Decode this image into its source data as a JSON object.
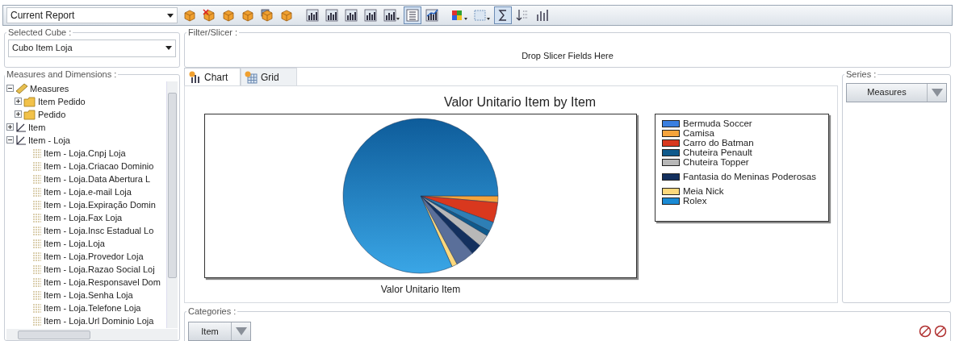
{
  "toolbar": {
    "report_select": {
      "value": "Current Report"
    },
    "buttons": [
      {
        "kind": "cube",
        "pressed": false
      },
      {
        "kind": "cube-delete",
        "pressed": false
      },
      {
        "kind": "cube",
        "pressed": false
      },
      {
        "kind": "cube",
        "pressed": false
      },
      {
        "kind": "cube-stack",
        "pressed": false
      },
      {
        "kind": "cube",
        "pressed": false
      },
      {
        "kind": "chart",
        "pressed": false
      },
      {
        "kind": "chart",
        "pressed": false
      },
      {
        "kind": "chart",
        "pressed": false
      },
      {
        "kind": "chart",
        "pressed": false
      },
      {
        "kind": "chart-menu",
        "pressed": false
      },
      {
        "kind": "list",
        "pressed": true
      },
      {
        "kind": "chart-line",
        "pressed": false
      },
      {
        "kind": "palette-menu",
        "pressed": false
      },
      {
        "kind": "grid-menu",
        "pressed": false
      },
      {
        "kind": "sum",
        "pressed": true
      },
      {
        "kind": "sort",
        "pressed": false
      },
      {
        "kind": "bars",
        "pressed": false
      }
    ]
  },
  "selected_cube": {
    "title": "Selected Cube :",
    "value": "Cubo Item Loja"
  },
  "filter_slicer": {
    "title": "Filter/Slicer :",
    "hint": "Drop Slicer Fields Here"
  },
  "measures_and_dimensions": {
    "title": "Measures and Dimensions :",
    "tree": [
      {
        "label": "Measures",
        "kind": "measures",
        "expanded": true,
        "children": [
          {
            "label": "Item Pedido",
            "kind": "folder",
            "expanded": false
          },
          {
            "label": "Pedido",
            "kind": "folder",
            "expanded": false
          }
        ]
      },
      {
        "label": "Item",
        "kind": "dimension",
        "expanded": false
      },
      {
        "label": "Item - Loja",
        "kind": "dimension",
        "expanded": true,
        "children": [
          {
            "label": "Item - Loja.Cnpj Loja",
            "kind": "attribute"
          },
          {
            "label": "Item - Loja.Criacao Dominio",
            "kind": "attribute"
          },
          {
            "label": "Item - Loja.Data Abertura L",
            "kind": "attribute"
          },
          {
            "label": "Item - Loja.e-mail Loja",
            "kind": "attribute"
          },
          {
            "label": "Item - Loja.Expiração Domin",
            "kind": "attribute"
          },
          {
            "label": "Item - Loja.Fax Loja",
            "kind": "attribute"
          },
          {
            "label": "Item - Loja.Insc Estadual Lo",
            "kind": "attribute"
          },
          {
            "label": "Item - Loja.Loja",
            "kind": "attribute"
          },
          {
            "label": "Item - Loja.Provedor Loja",
            "kind": "attribute"
          },
          {
            "label": "Item - Loja.Razao Social Loj",
            "kind": "attribute"
          },
          {
            "label": "Item - Loja.Responsavel Dom",
            "kind": "attribute"
          },
          {
            "label": "Item - Loja.Senha Loja",
            "kind": "attribute"
          },
          {
            "label": "Item - Loja.Telefone Loja",
            "kind": "attribute"
          },
          {
            "label": "Item - Loja.Url Dominio Loja",
            "kind": "attribute"
          }
        ]
      }
    ]
  },
  "tabs": [
    {
      "label": "Chart",
      "kind": "chart",
      "selected": true
    },
    {
      "label": "Grid",
      "kind": "grid",
      "selected": false
    }
  ],
  "chart": {
    "title": "Valor Unitario Item by Item",
    "xlabel": "Valor Unitario Item",
    "legend": [
      {
        "label": "Bermuda Soccer",
        "color": "#3a7fe0"
      },
      {
        "label": "Camisa",
        "color": "#f5a43c"
      },
      {
        "label": "Carro do Batman",
        "color": "#d9381e"
      },
      {
        "label": "Chuteira Penault",
        "color": "#0f5a8c"
      },
      {
        "label": "Chuteira Topper",
        "color": "#b8b8b8"
      },
      {
        "label": "Fantasia do Meninas Poderosas",
        "color": "#13305e"
      },
      {
        "label": "Meia Nick",
        "color": "#fcd87c"
      },
      {
        "label": "Rolex",
        "color": "#1a8ad4"
      }
    ]
  },
  "series": {
    "title": "Series :",
    "fields": [
      {
        "label": "Measures"
      }
    ]
  },
  "categories": {
    "title": "Categories :",
    "fields": [
      {
        "label": "Item"
      }
    ]
  }
}
